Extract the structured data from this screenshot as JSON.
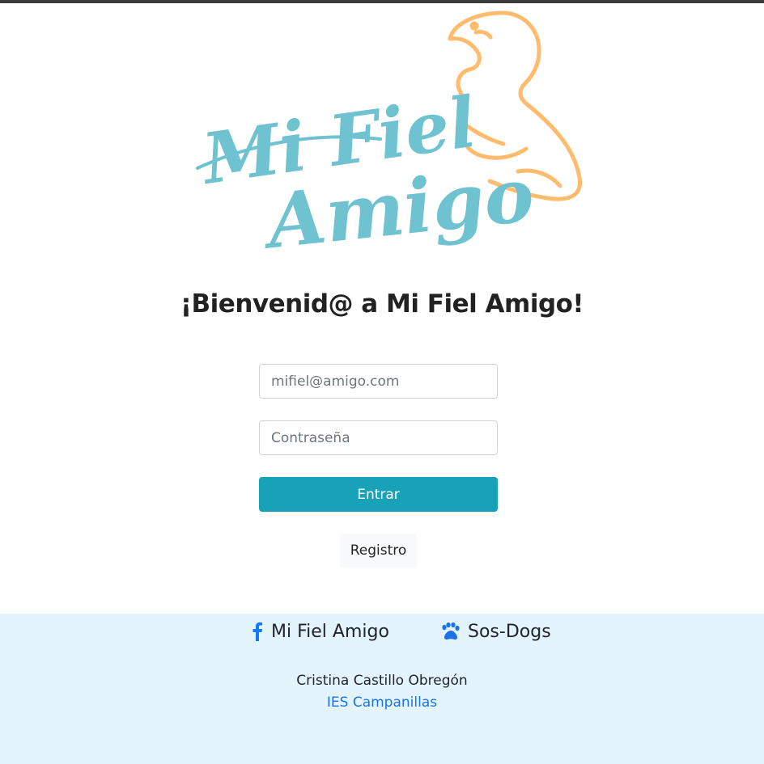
{
  "logo": {
    "line1": "Mi Fiel",
    "line2": "Amigo",
    "text_color": "#6fc2cf",
    "dog_color": "#ffbb6e"
  },
  "welcome": {
    "title": "¡Bienvenid@ a Mi Fiel Amigo!"
  },
  "login": {
    "email_placeholder": "mifiel@amigo.com",
    "password_placeholder": "Contraseña",
    "submit_label": "Entrar",
    "register_label": "Registro",
    "accent": "#17a2b8"
  },
  "footer": {
    "social": [
      {
        "icon": "facebook-icon",
        "label": "Mi Fiel Amigo",
        "icon_color": "#1877f2"
      },
      {
        "icon": "paw-icon",
        "label": "Sos-Dogs",
        "icon_color": "#1a73e8"
      }
    ],
    "author": "Cristina Castillo Obregón",
    "school": "IES Campanillas",
    "background": "#e3f4fd"
  }
}
